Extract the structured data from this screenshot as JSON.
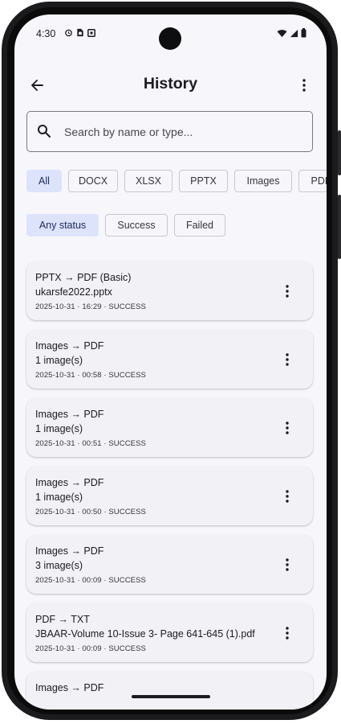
{
  "status_bar": {
    "time": "4:30"
  },
  "app_bar": {
    "title": "History"
  },
  "search": {
    "placeholder": "Search by name or type..."
  },
  "type_filters": [
    {
      "label": "All",
      "selected": true
    },
    {
      "label": "DOCX",
      "selected": false
    },
    {
      "label": "XLSX",
      "selected": false
    },
    {
      "label": "PPTX",
      "selected": false
    },
    {
      "label": "Images",
      "selected": false
    },
    {
      "label": "PDF",
      "selected": false
    }
  ],
  "status_filters": [
    {
      "label": "Any status",
      "selected": true
    },
    {
      "label": "Success",
      "selected": false
    },
    {
      "label": "Failed",
      "selected": false
    }
  ],
  "history": [
    {
      "title": "PPTX → PDF (Basic)",
      "subtitle": "ukarsfe2022.pptx",
      "meta": "2025-10-31 · 16:29 · SUCCESS"
    },
    {
      "title": "Images → PDF",
      "subtitle": "1 image(s)",
      "meta": "2025-10-31 · 00:58 · SUCCESS"
    },
    {
      "title": "Images → PDF",
      "subtitle": "1 image(s)",
      "meta": "2025-10-31 · 00:51 · SUCCESS"
    },
    {
      "title": "Images → PDF",
      "subtitle": "1 image(s)",
      "meta": "2025-10-31 · 00:50 · SUCCESS"
    },
    {
      "title": "Images → PDF",
      "subtitle": "3 image(s)",
      "meta": "2025-10-31 · 00:09 · SUCCESS"
    },
    {
      "title": "PDF → TXT",
      "subtitle": "JBAAR-Volume 10-Issue 3- Page 641-645 (1).pdf",
      "meta": "2025-10-31 · 00:09 · SUCCESS"
    },
    {
      "title": "Images → PDF",
      "subtitle": "",
      "meta": ""
    }
  ],
  "colors": {
    "accent_chip": "#dde3fb",
    "background": "#f7f7fb",
    "card": "#f1f1f6"
  }
}
